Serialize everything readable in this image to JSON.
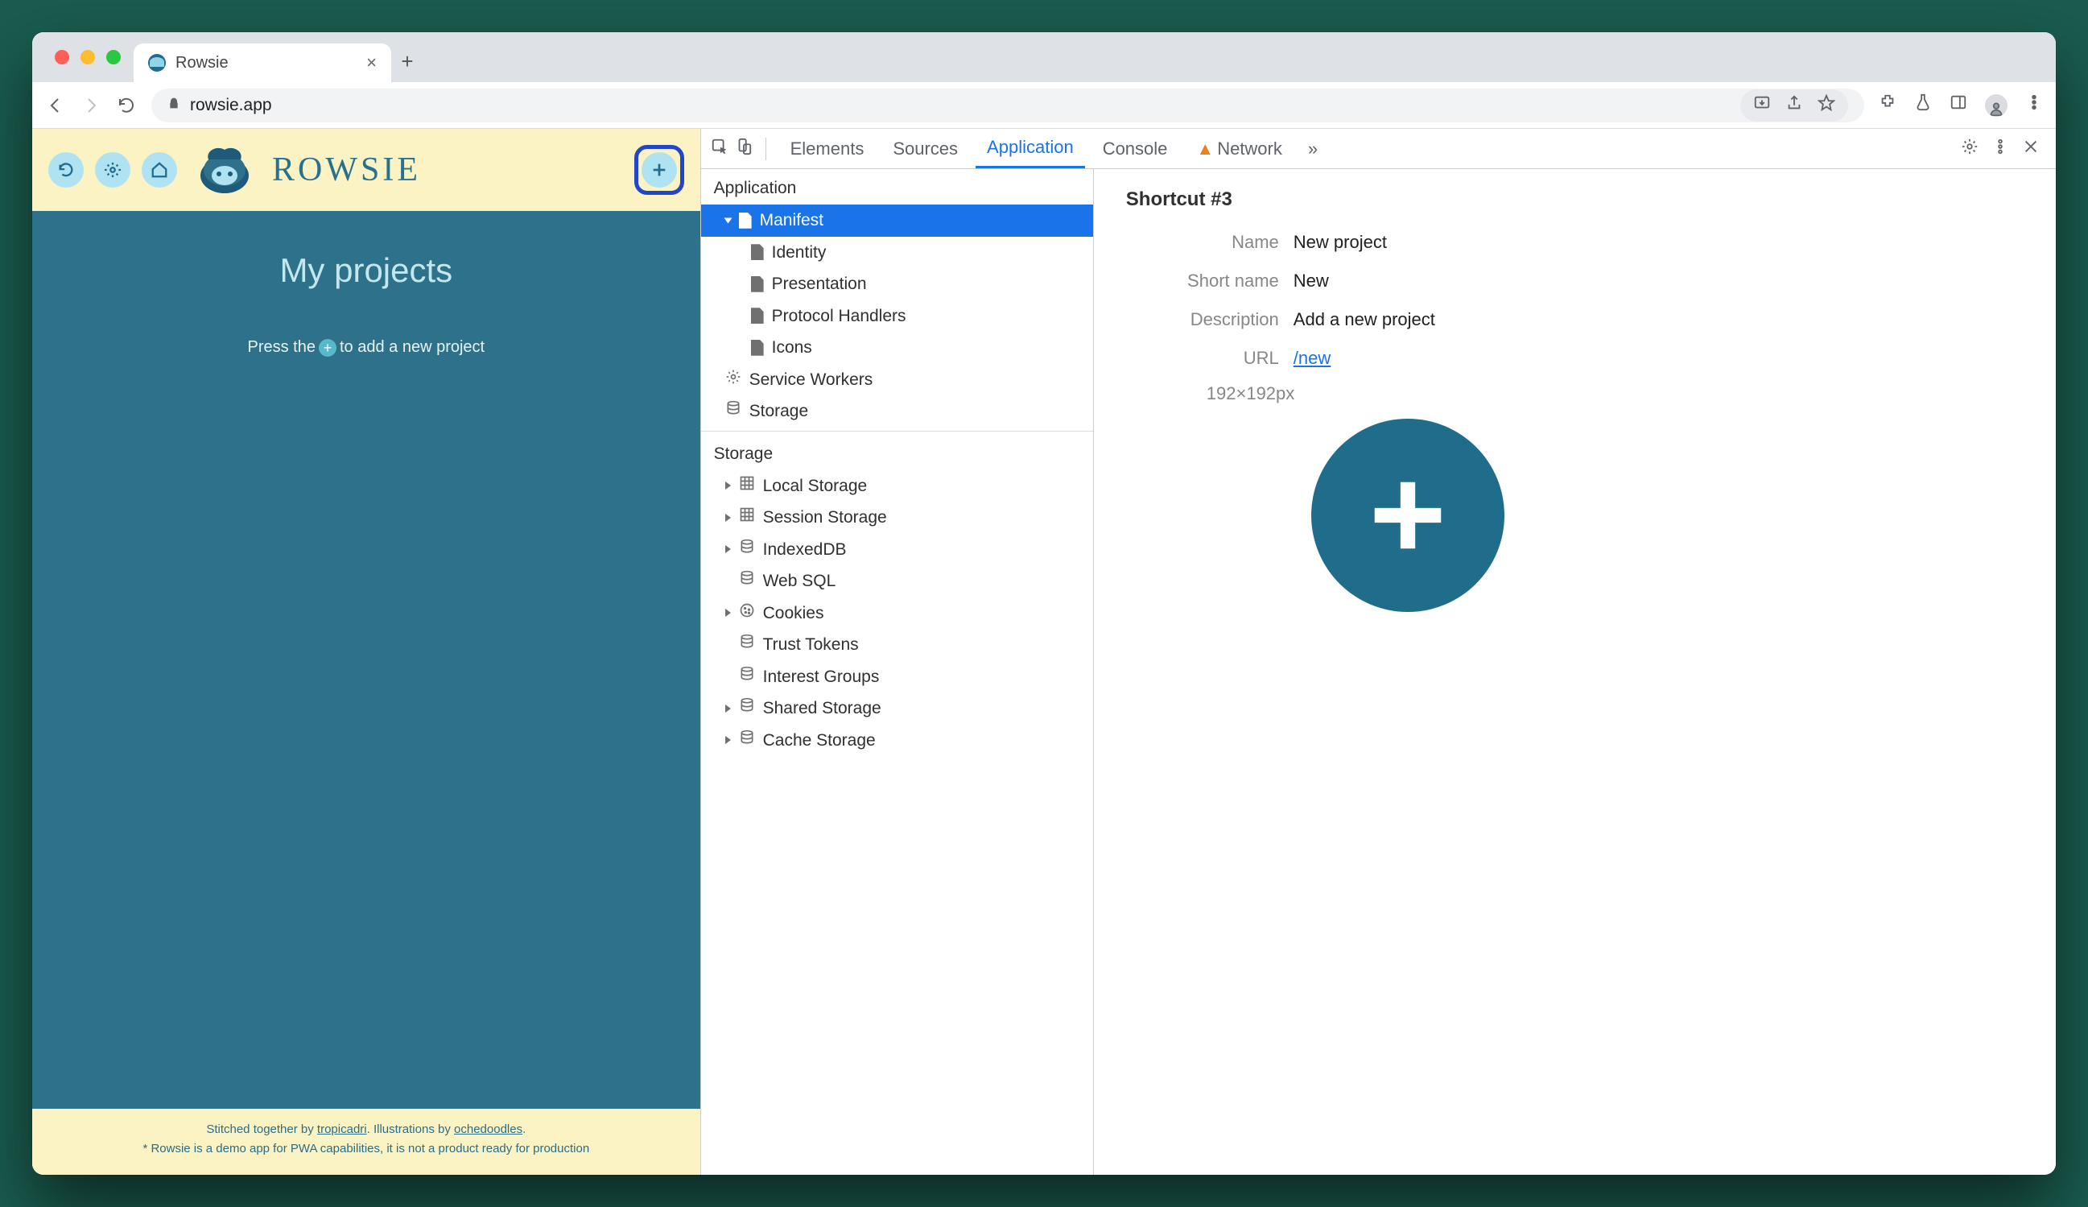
{
  "browser": {
    "tab_title": "Rowsie",
    "address": "rowsie.app"
  },
  "rowsie": {
    "wordmark": "ROWSIE",
    "heading": "My projects",
    "empty_pre": "Press the",
    "empty_post": "to add a new project",
    "footer1_pre": "Stitched together by ",
    "footer1_link1": "tropicadri",
    "footer1_mid": ". Illustrations by ",
    "footer1_link2": "ochedoodles",
    "footer1_post": ".",
    "footer2": "* Rowsie is a demo app for PWA capabilities, it is not a product ready for production"
  },
  "devtools": {
    "tabs": {
      "elements": "Elements",
      "sources": "Sources",
      "application": "Application",
      "console": "Console",
      "network": "Network"
    },
    "sidebar": {
      "group_app": "Application",
      "manifest": "Manifest",
      "identity": "Identity",
      "presentation": "Presentation",
      "protocol": "Protocol Handlers",
      "icons": "Icons",
      "service_workers": "Service Workers",
      "storage": "Storage",
      "group_storage": "Storage",
      "local_storage": "Local Storage",
      "session_storage": "Session Storage",
      "indexeddb": "IndexedDB",
      "websql": "Web SQL",
      "cookies": "Cookies",
      "trust_tokens": "Trust Tokens",
      "interest_groups": "Interest Groups",
      "shared_storage": "Shared Storage",
      "cache_storage": "Cache Storage"
    },
    "detail": {
      "heading": "Shortcut #3",
      "k_name": "Name",
      "v_name": "New project",
      "k_short": "Short name",
      "v_short": "New",
      "k_desc": "Description",
      "v_desc": "Add a new project",
      "k_url": "URL",
      "v_url": "/new",
      "dim": "192×192px"
    }
  }
}
